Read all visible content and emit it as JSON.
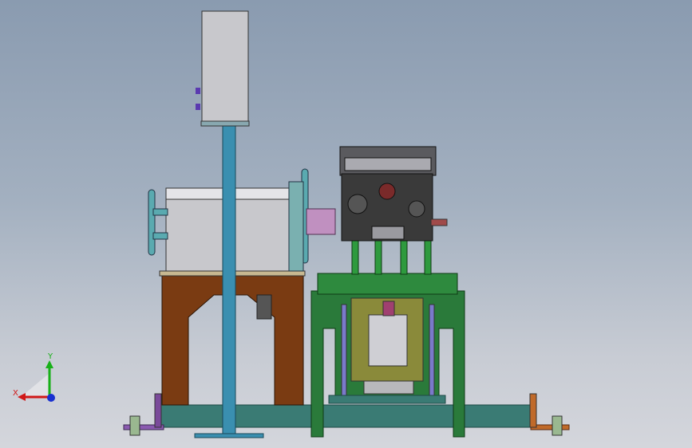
{
  "viewport": {
    "background_top": "#8a9bb0",
    "background_bottom": "#d4d6dc"
  },
  "triad": {
    "x_label": "X",
    "y_label": "Y",
    "x_color": "#d01818",
    "y_color": "#18b018",
    "z_color": "#1830d0"
  },
  "model": {
    "frame_color": "#7a3b12",
    "pole_color": "#3a8fb0",
    "base_color": "#3a7b74",
    "support_color": "#2a7a3a",
    "fixture_color": "#8a8a3a",
    "engine_color": "#3a3a3a"
  }
}
